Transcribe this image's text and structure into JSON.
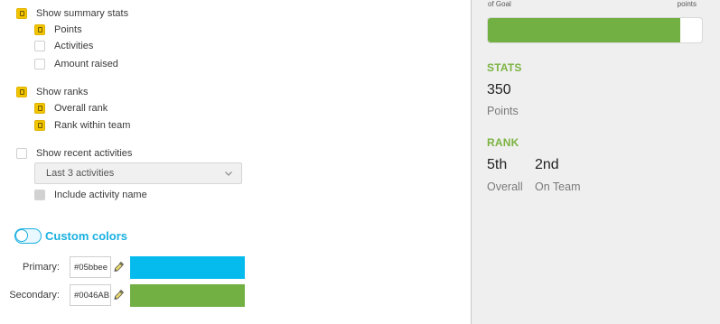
{
  "settings": {
    "summary_stats": {
      "label": "Show summary stats",
      "checked": true,
      "options": [
        {
          "label": "Points",
          "checked": true
        },
        {
          "label": "Activities",
          "checked": false
        },
        {
          "label": "Amount raised",
          "checked": false
        }
      ]
    },
    "ranks": {
      "label": "Show ranks",
      "checked": true,
      "options": [
        {
          "label": "Overall rank",
          "checked": true
        },
        {
          "label": "Rank within team",
          "checked": true
        }
      ]
    },
    "recent_activities": {
      "label": "Show recent activities",
      "checked": false,
      "select_value": "Last 3 activities",
      "include_name_label": "Include activity name"
    },
    "custom_colors": {
      "label": "Custom colors",
      "enabled": true,
      "primary": {
        "label": "Primary:",
        "hex": "#05bbee",
        "swatch": "#05bbee"
      },
      "secondary": {
        "label": "Secondary:",
        "hex": "#0046AB",
        "swatch": "#72b043"
      }
    }
  },
  "preview": {
    "goal_label": "of Goal",
    "points_label": "points",
    "progress_fraction": 0.9,
    "stats": {
      "title": "STATS",
      "value": "350",
      "caption": "Points"
    },
    "rank": {
      "title": "RANK",
      "overall": {
        "value": "5th",
        "caption": "Overall"
      },
      "team": {
        "value": "2nd",
        "caption": "On Team"
      }
    }
  },
  "colors": {
    "accent": "#1ab0e0",
    "checkbox_on": "#f2c500",
    "stats_green": "#7cb342",
    "bar_fill": "#72b043"
  },
  "icons": {
    "picker": "eyedropper-icon",
    "select": "chevron-down-icon"
  }
}
